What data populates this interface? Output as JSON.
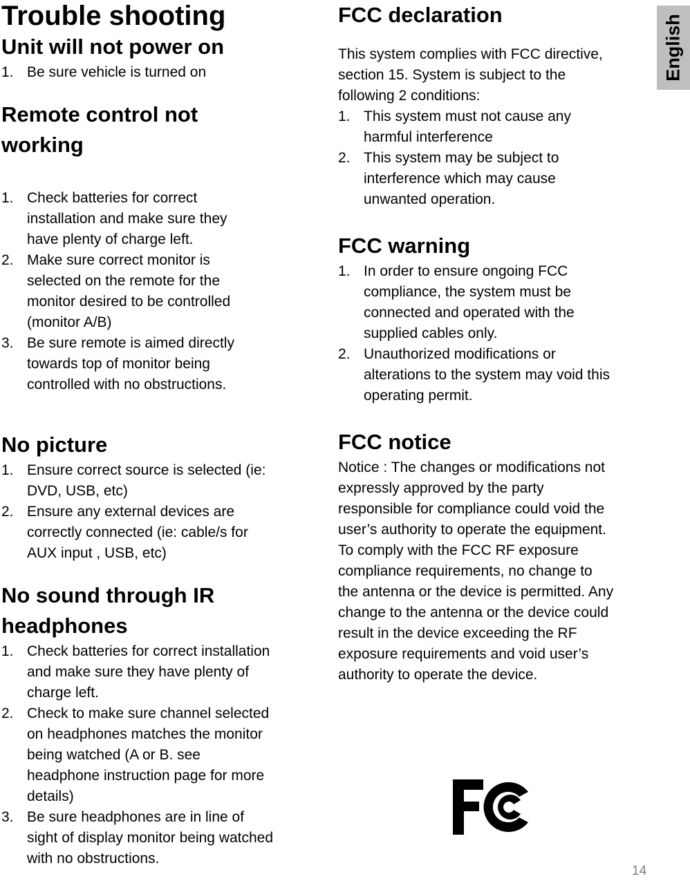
{
  "side_tab": {
    "label": "English"
  },
  "left": {
    "title": "Trouble shooting",
    "sections": [
      {
        "heading": "Unit will not power on",
        "items": [
          "Be sure vehicle is turned on"
        ]
      },
      {
        "heading": "Remote control not working",
        "items": [
          "Check batteries for correct installation and make sure they have  plenty of charge left.",
          "Make sure correct monitor is selected on the remote for the monitor desired to be controlled (monitor A/B)",
          "Be sure remote is aimed directly towards top of monitor being controlled with no obstructions."
        ]
      },
      {
        "heading": "No picture",
        "items": [
          "Ensure correct source is selected (ie: DVD, USB, etc)",
          "Ensure any external devices are correctly connected (ie: cable/s for AUX input , USB, etc)"
        ]
      },
      {
        "heading": "No sound through IR headphones",
        "items": [
          "Check batteries for correct installation and make sure they have  plenty of charge left.",
          "Check to make sure channel selected on headphones matches the monitor being watched (A or B. see headphone instruction page for more details)",
          "Be sure headphones are in line of sight of display monitor being watched with no obstructions."
        ]
      }
    ]
  },
  "right": {
    "declaration": {
      "heading": "FCC declaration",
      "intro": "This system complies with FCC directive, section 15. System is subject to the following 2 conditions:",
      "items": [
        "This system must not cause any harmful interference",
        "This system may be subject to interference which may cause unwanted operation."
      ]
    },
    "warning": {
      "heading": "FCC warning",
      "items": [
        "In order to ensure ongoing FCC compliance, the system must be connected and operated with the supplied cables only.",
        "Unauthorized modifications or alterations to the system may void this operating permit."
      ]
    },
    "notice": {
      "heading": "FCC notice",
      "paragraphs": [
        "Notice : The changes or modifications not expressly approved by the party responsible for compliance could void the user’s authority to operate the equipment.",
        "To comply with the FCC RF exposure compliance requirements, no change to the antenna or the device is permitted. Any change to the antenna or the device could result in the device exceeding the RF exposure requirements and void user’s authority to operate the device."
      ]
    }
  },
  "logo": {
    "icon": "fcc-logo-icon"
  },
  "page_number": "14"
}
